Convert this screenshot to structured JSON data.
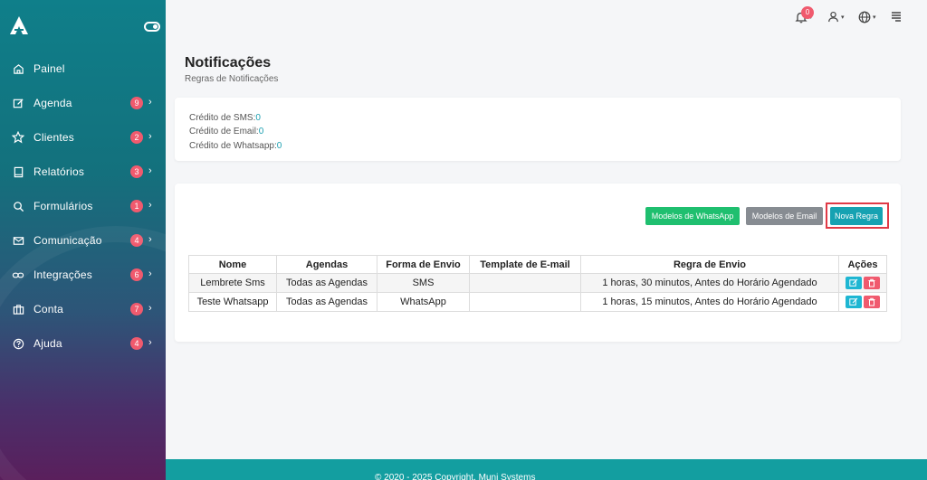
{
  "sidebar": {
    "items": [
      {
        "label": "Painel",
        "icon": "home-icon",
        "badge": ""
      },
      {
        "label": "Agenda",
        "icon": "edit-icon",
        "badge": "9"
      },
      {
        "label": "Clientes",
        "icon": "star-icon",
        "badge": "2"
      },
      {
        "label": "Relatórios",
        "icon": "book-icon",
        "badge": "3"
      },
      {
        "label": "Formulários",
        "icon": "search-icon",
        "badge": "1"
      },
      {
        "label": "Comunicação",
        "icon": "mail-icon",
        "badge": "4"
      },
      {
        "label": "Integrações",
        "icon": "link-icon",
        "badge": "6"
      },
      {
        "label": "Conta",
        "icon": "briefcase-icon",
        "badge": "7"
      },
      {
        "label": "Ajuda",
        "icon": "help-icon",
        "badge": "4"
      }
    ]
  },
  "topbar": {
    "notification_count": "0",
    "icons": [
      "bell-icon",
      "user-icon",
      "globe-icon",
      "menu-icon"
    ]
  },
  "header": {
    "title": "Notificações",
    "subtitle": "Regras de Notificações"
  },
  "credits": {
    "sms_label": "Crédito de SMS:",
    "sms_value": "0",
    "email_label": "Crédito de Email:",
    "email_value": "0",
    "whatsapp_label": "Crédito de Whatsapp:",
    "whatsapp_value": "0"
  },
  "toolbar": {
    "whatsapp_templates": "Modelos de WhatsApp",
    "email_templates": "Modelos de Email",
    "new_rule": "Nova Regra"
  },
  "table": {
    "headers": [
      "Nome",
      "Agendas",
      "Forma de Envio",
      "Template de E-mail",
      "Regra de Envio",
      "Ações"
    ],
    "rows": [
      [
        "Lembrete Sms",
        "Todas as Agendas",
        "SMS",
        "",
        "1 horas, 30 minutos, Antes do Horário Agendado"
      ],
      [
        "Teste Whatsapp",
        "Todas as Agendas",
        "WhatsApp",
        "",
        "1 horas, 15 minutos, Antes do Horário Agendado"
      ]
    ]
  },
  "footer": {
    "text": "© 2020 - 2025 Copyright. Muni Systems"
  },
  "colors": {
    "accent": "#16a2b2",
    "badge": "#f05a6e",
    "whatsapp_button": "#1fbf6f",
    "email_button": "#878c92",
    "footer": "#139ea0"
  }
}
